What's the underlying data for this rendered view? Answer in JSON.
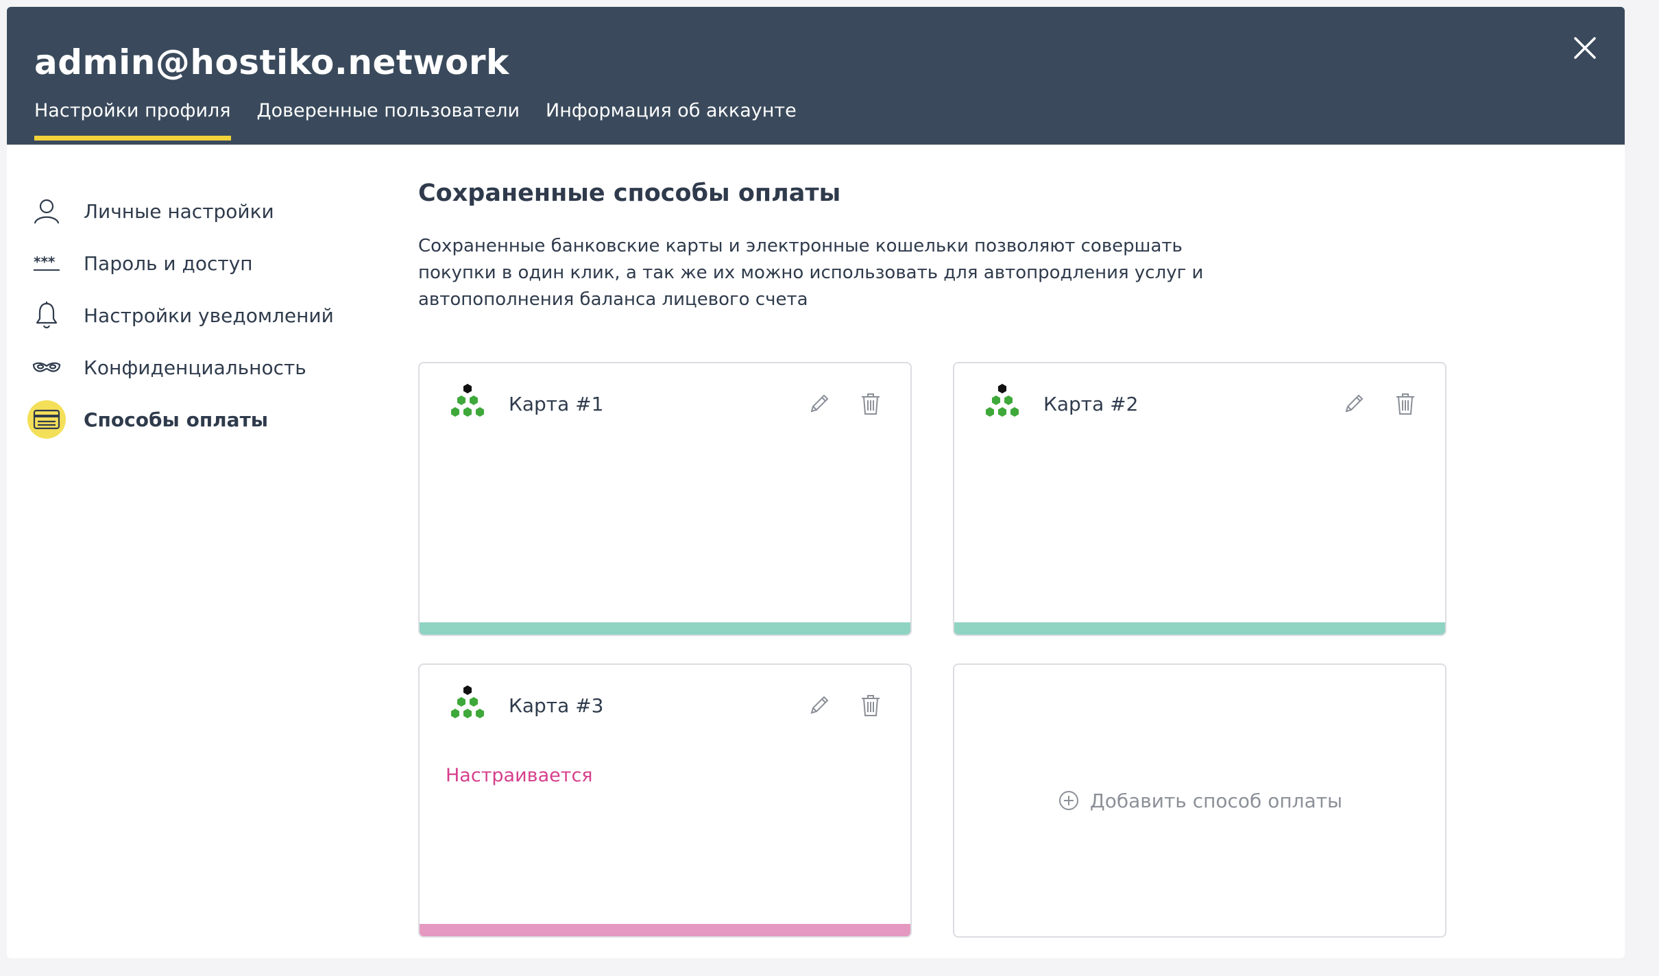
{
  "header": {
    "title": "admin@hostiko.network",
    "tabs": [
      {
        "label": "Настройки профиля",
        "active": true
      },
      {
        "label": "Доверенные пользователи",
        "active": false
      },
      {
        "label": "Информация об аккаунте",
        "active": false
      }
    ],
    "close_icon": "close-icon",
    "active_tab_color": "#f4d23a",
    "background_color": "#3a4a5c"
  },
  "sidebar": {
    "items": [
      {
        "label": "Личные настройки",
        "icon": "user-icon",
        "active": false
      },
      {
        "label": "Пароль и доступ",
        "icon": "password-icon",
        "active": false
      },
      {
        "label": "Настройки уведомлений",
        "icon": "bell-icon",
        "active": false
      },
      {
        "label": "Конфиденциальность",
        "icon": "mask-icon",
        "active": false
      },
      {
        "label": "Способы оплаты",
        "icon": "credit-card-icon",
        "active": true
      }
    ],
    "active_highlight_color": "#f4df59"
  },
  "main": {
    "title": "Сохраненные способы оплаты",
    "description": "Сохраненные банковские карты и электронные кошельки позволяют совершать покупки в один клик, а так же их можно использовать для автопродления услуг и автопополнения баланса лицевого счета",
    "cards": [
      {
        "name": "Карта #1",
        "status": "",
        "bar_color": "#8fd3c2"
      },
      {
        "name": "Карта #2",
        "status": "",
        "bar_color": "#8fd3c2"
      },
      {
        "name": "Карта #3",
        "status": "Настраивается",
        "bar_color": "#e598c0"
      }
    ],
    "card_icons": {
      "logo": "bank-logo-icon",
      "edit": "pencil-icon",
      "delete": "trash-icon"
    },
    "add_button": {
      "label": "Добавить способ оплаты",
      "icon": "plus-circle-icon"
    },
    "status_color": "#d63f8c"
  }
}
